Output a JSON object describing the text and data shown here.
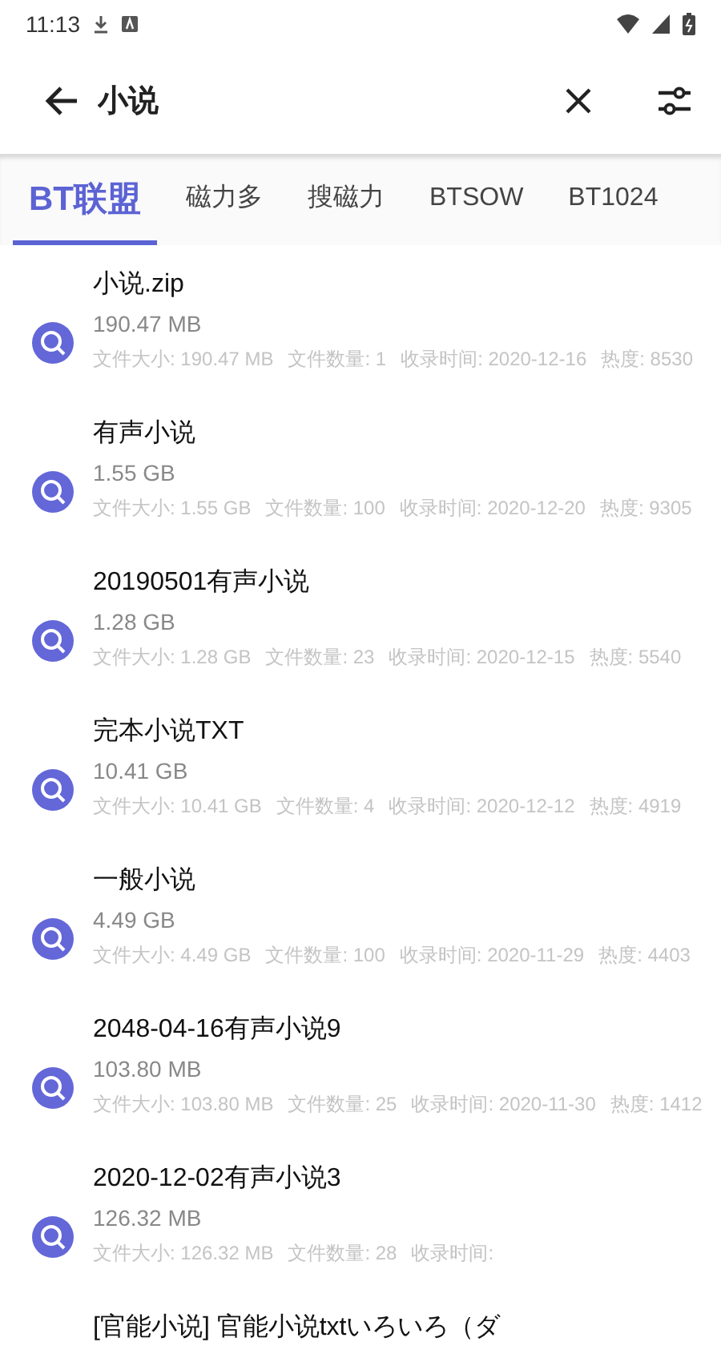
{
  "status_bar": {
    "time": "11:13"
  },
  "search": {
    "value": "小说"
  },
  "tabs": [
    {
      "label": "BT联盟",
      "selected": true
    },
    {
      "label": "磁力多",
      "selected": false
    },
    {
      "label": "搜磁力",
      "selected": false
    },
    {
      "label": "BTSOW",
      "selected": false
    },
    {
      "label": "BT1024",
      "selected": false
    }
  ],
  "results": [
    {
      "title": "小说.zip",
      "size": "190.47 MB",
      "meta": [
        "文件大小: 190.47 MB",
        "文件数量: 1",
        "收录时间: 2020-12-16",
        "热度: 8530"
      ]
    },
    {
      "title": "有声小说",
      "size": "1.55 GB",
      "meta": [
        "文件大小: 1.55 GB",
        "文件数量: 100",
        "收录时间: 2020-12-20",
        "热度: 9305"
      ]
    },
    {
      "title": "20190501有声小说",
      "size": "1.28 GB",
      "meta": [
        "文件大小: 1.28 GB",
        "文件数量: 23",
        "收录时间: 2020-12-15",
        "热度: 5540"
      ]
    },
    {
      "title": "完本小说TXT",
      "size": "10.41 GB",
      "meta": [
        "文件大小: 10.41 GB",
        "文件数量: 4",
        "收录时间: 2020-12-12",
        "热度: 4919"
      ]
    },
    {
      "title": "一般小说",
      "size": "4.49 GB",
      "meta": [
        "文件大小: 4.49 GB",
        "文件数量: 100",
        "收录时间: 2020-11-29",
        "热度: 4403"
      ]
    },
    {
      "title": "2048-04-16有声小说9",
      "size": "103.80 MB",
      "meta": [
        "文件大小: 103.80 MB",
        "文件数量: 25",
        "收录时间: 2020-11-30",
        "热度: 1412"
      ]
    },
    {
      "title": "2020-12-02有声小说3",
      "size": "126.32 MB",
      "meta": [
        "文件大小: 126.32 MB",
        "文件数量: 28",
        "收录时间:"
      ]
    },
    {
      "title": "[官能小说] 官能小说txtいろいろ（ダ"
    }
  ]
}
